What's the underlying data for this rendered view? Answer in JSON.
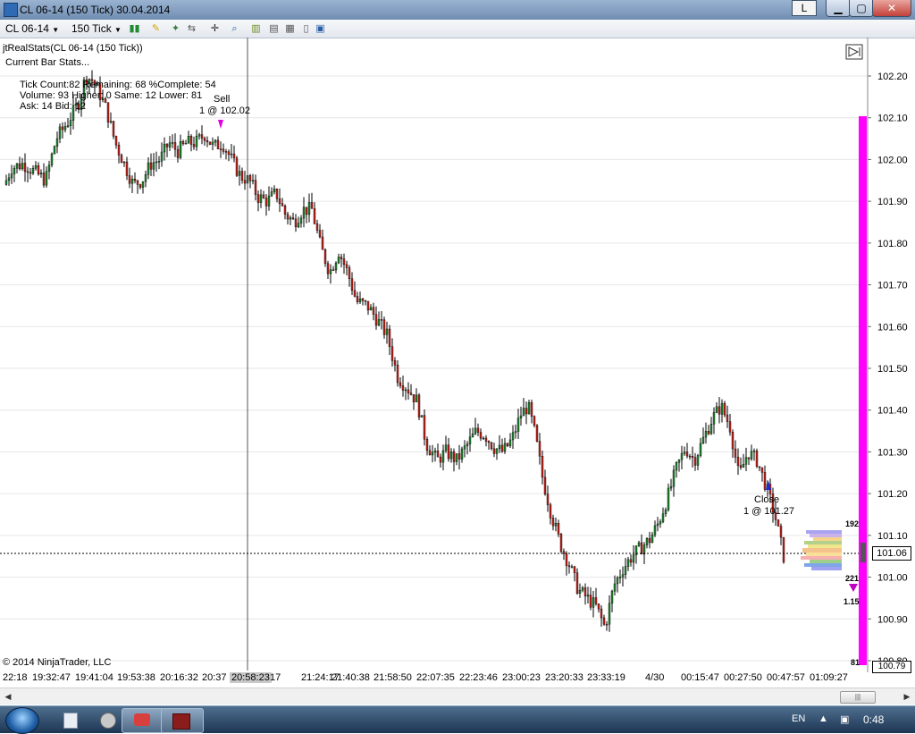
{
  "window": {
    "title": "CL 06-14 (150 Tick)  30.04.2014",
    "btn_l": "L",
    "btn_min": "▁",
    "btn_max": "▢",
    "btn_close": "✕"
  },
  "toolbar": {
    "instrument": "CL 06-14",
    "interval": "150 Tick",
    "icons": [
      "bars-icon",
      "pencil-icon",
      "wand-icon",
      "arrows-icon",
      "crosshair-icon",
      "zoom-icon",
      "data-box-icon",
      "properties-icon",
      "template-icon",
      "panel-icon"
    ]
  },
  "overlay": {
    "indicator_label": "jtRealStats(CL 06-14 (150 Tick))",
    "current_bar_stats": "Current Bar Stats...",
    "stats_line1": "Tick Count:82   Remaining: 68   %Complete: 54",
    "stats_line2": "Volume: 93   Higher: 0   Same: 12   Lower: 81",
    "stats_line3": "Ask: 14   Bid: 12",
    "copyright": "© 2014 NinjaTrader, LLC"
  },
  "trade_markers": {
    "sell_label": "Sell",
    "sell_detail": "1 @ 102.02",
    "close_label": "Close",
    "close_detail": "1 @ 101.27"
  },
  "volume_profile": {
    "top_value": "192",
    "mid_value": "221",
    "ratio_value": "1.15",
    "bottom_value": "81"
  },
  "colors": {
    "up_candle": "#1f8a2e",
    "down_candle": "#c8221c",
    "magenta_bar": "#ff00ff",
    "price_line": "#000000"
  },
  "chart_data": {
    "type": "candlestick",
    "y_axis": {
      "ticks": [
        "102.20",
        "102.10",
        "102.00",
        "101.90",
        "101.80",
        "101.70",
        "101.60",
        "101.50",
        "101.40",
        "101.30",
        "101.20",
        "101.10",
        "101.00",
        "100.90",
        "100.80"
      ],
      "ylim": [
        100.79,
        102.24
      ]
    },
    "x_axis": {
      "tick_labels": [
        "22:18",
        "19:32:47",
        "19:41:04",
        "19:53:38",
        "20:16:32",
        "20:37",
        "20:58:23",
        "17",
        "21:24:17",
        "21:40:38",
        "21:58:50",
        "22:07:35",
        "22:23:46",
        "23:00:23",
        "23:20:33",
        "23:33:19",
        "4/30",
        "00:15:47",
        "00:27:50",
        "00:47:57",
        "01:09:27"
      ],
      "highlighted_label": "20:58:23"
    },
    "last_price": "101.06",
    "low_marker": "100.79",
    "close_path": [
      [
        0,
        101.92
      ],
      [
        12,
        101.98
      ],
      [
        25,
        101.99
      ],
      [
        38,
        101.97
      ],
      [
        50,
        101.95
      ],
      [
        62,
        102.05
      ],
      [
        75,
        102.09
      ],
      [
        88,
        102.14
      ],
      [
        95,
        102.2
      ],
      [
        102,
        102.19
      ],
      [
        110,
        102.16
      ],
      [
        118,
        102.12
      ],
      [
        128,
        102.04
      ],
      [
        138,
        101.99
      ],
      [
        148,
        101.94
      ],
      [
        158,
        101.95
      ],
      [
        168,
        101.99
      ],
      [
        178,
        102.0
      ],
      [
        188,
        102.04
      ],
      [
        198,
        102.02
      ],
      [
        208,
        102.04
      ],
      [
        218,
        102.04
      ],
      [
        228,
        102.06
      ],
      [
        238,
        102.03
      ],
      [
        248,
        102.04
      ],
      [
        258,
        102.0
      ],
      [
        268,
        101.96
      ],
      [
        278,
        101.95
      ],
      [
        288,
        101.91
      ],
      [
        298,
        101.9
      ],
      [
        308,
        101.92
      ],
      [
        318,
        101.87
      ],
      [
        328,
        101.85
      ],
      [
        338,
        101.88
      ],
      [
        348,
        101.88
      ],
      [
        358,
        101.79
      ],
      [
        368,
        101.73
      ],
      [
        378,
        101.78
      ],
      [
        388,
        101.73
      ],
      [
        398,
        101.66
      ],
      [
        410,
        101.65
      ],
      [
        420,
        101.62
      ],
      [
        432,
        101.58
      ],
      [
        444,
        101.48
      ],
      [
        456,
        101.45
      ],
      [
        466,
        101.42
      ],
      [
        476,
        101.32
      ],
      [
        488,
        101.28
      ],
      [
        498,
        101.3
      ],
      [
        510,
        101.28
      ],
      [
        520,
        101.31
      ],
      [
        532,
        101.35
      ],
      [
        542,
        101.34
      ],
      [
        552,
        101.31
      ],
      [
        562,
        101.3
      ],
      [
        572,
        101.33
      ],
      [
        582,
        101.39
      ],
      [
        590,
        101.41
      ],
      [
        598,
        101.34
      ],
      [
        606,
        101.24
      ],
      [
        616,
        101.15
      ],
      [
        626,
        101.08
      ],
      [
        636,
        101.03
      ],
      [
        646,
        100.97
      ],
      [
        656,
        100.95
      ],
      [
        666,
        100.93
      ],
      [
        676,
        100.88
      ],
      [
        686,
        100.98
      ],
      [
        696,
        101.02
      ],
      [
        706,
        101.05
      ],
      [
        716,
        101.07
      ],
      [
        726,
        101.09
      ],
      [
        736,
        101.13
      ],
      [
        746,
        101.19
      ],
      [
        756,
        101.26
      ],
      [
        766,
        101.31
      ],
      [
        776,
        101.28
      ],
      [
        786,
        101.33
      ],
      [
        796,
        101.38
      ],
      [
        806,
        101.41
      ],
      [
        816,
        101.36
      ],
      [
        826,
        101.24
      ],
      [
        836,
        101.3
      ],
      [
        846,
        101.28
      ],
      [
        856,
        101.22
      ],
      [
        866,
        101.15
      ],
      [
        876,
        101.05
      ]
    ]
  },
  "taskbar": {
    "lang": "EN",
    "time": "0:48"
  }
}
